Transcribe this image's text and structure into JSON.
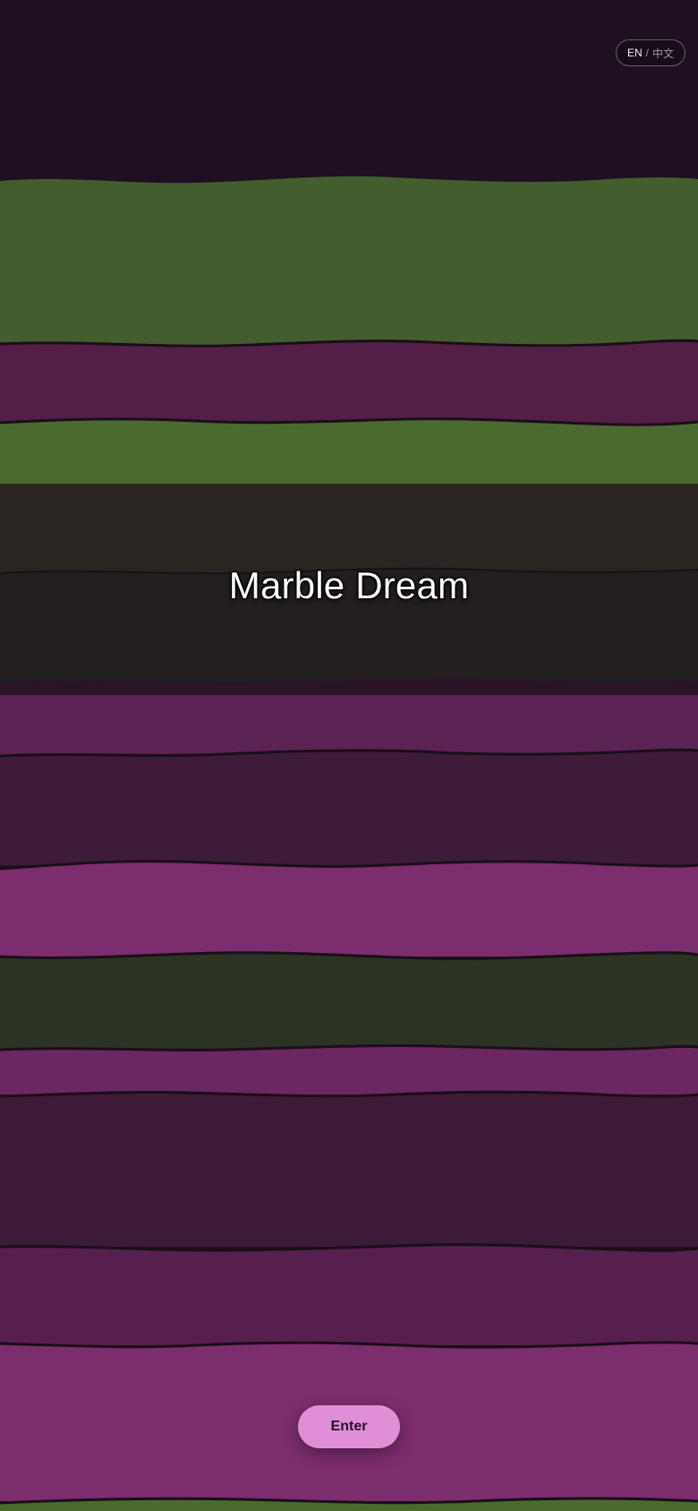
{
  "language_toggle": {
    "current": "EN",
    "separator": "/",
    "alternate": "中文"
  },
  "title": "Marble Dream",
  "enter_button": {
    "label": "Enter"
  },
  "colors": {
    "background": "#1e1020",
    "green": "#445d2e",
    "bright_green": "#4b6a30",
    "deep_purple": "#521f47",
    "dark_olive": "#2a2520",
    "charcoal": "#231e1f",
    "violet": "#5b2353",
    "plum": "#3d1b39",
    "magenta": "#7b2d6d",
    "moss": "#2d3324",
    "button": "#e08fd6"
  }
}
